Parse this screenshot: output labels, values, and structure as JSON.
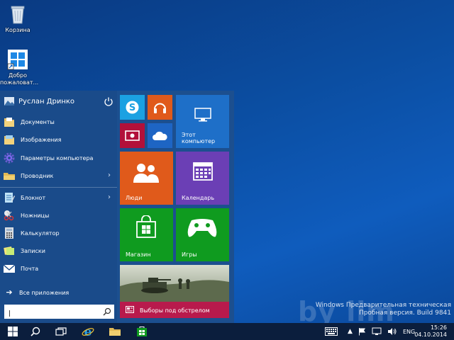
{
  "desktop": {
    "icons": [
      {
        "label": "Корзина"
      },
      {
        "label": "Добро пожаловат..."
      }
    ]
  },
  "start_menu": {
    "user_name": "Руслан Дринко",
    "items": [
      {
        "label": "Документы"
      },
      {
        "label": "Изображения"
      },
      {
        "label": "Параметры компьютера"
      },
      {
        "label": "Проводник"
      },
      {
        "label": "Блокнот"
      },
      {
        "label": "Ножницы"
      },
      {
        "label": "Калькулятор"
      },
      {
        "label": "Записки"
      },
      {
        "label": "Почта"
      }
    ],
    "all_apps": "Все приложения",
    "search_value": "|"
  },
  "tiles": {
    "computer": "Этот компьютер",
    "people": "Люди",
    "calendar": "Календарь",
    "store": "Магазин",
    "games": "Игры",
    "news": "Выборы под обстрелом"
  },
  "watermark": {
    "line1": "Windows Предварительная техническая",
    "line2": "Пробная версия. Build 9841",
    "brand": "by lim"
  },
  "taskbar": {
    "language": "ENG",
    "time": "15:26",
    "date": "04.10.2014"
  },
  "colors": {
    "skype": "#1ba1e2",
    "music": "#e05a1b",
    "video": "#b2103a",
    "onedrive": "#1e65c4",
    "computer": "#1e6fc8",
    "people": "#e05a1b",
    "calendar": "#6b3fb5",
    "store": "#0f9b1f",
    "games": "#0f9b1f",
    "news": "#b81a4c"
  }
}
